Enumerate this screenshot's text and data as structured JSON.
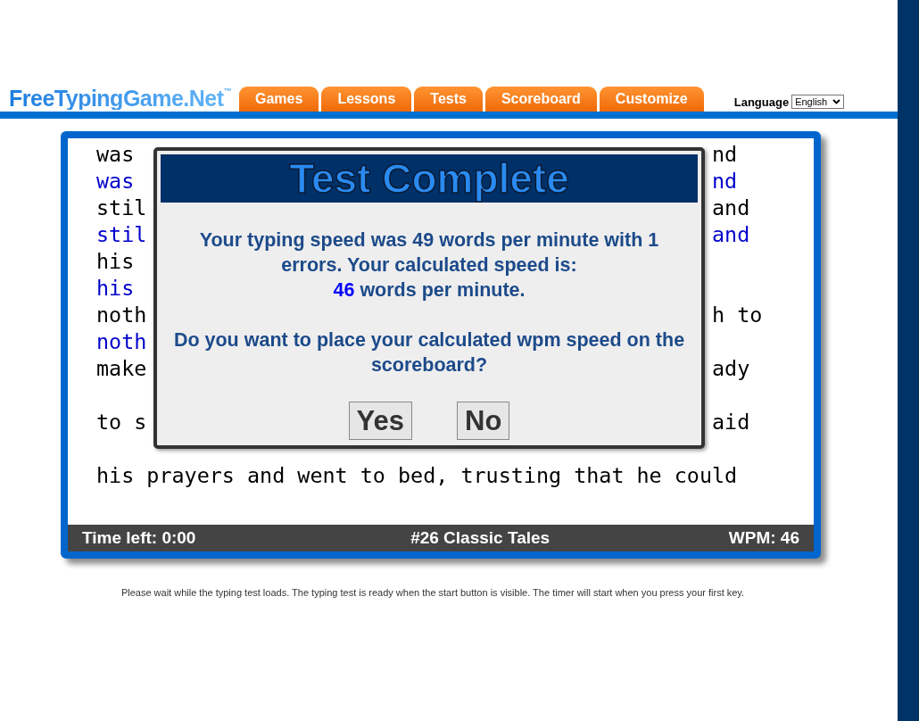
{
  "logo": {
    "name": "FreeTypingGame.Net",
    "mark": "™"
  },
  "nav_tabs": [
    "Games",
    "Lessons",
    "Tests",
    "Scoreboard",
    "Customize"
  ],
  "language": {
    "label": "Language",
    "value": "English"
  },
  "typing_text": [
    {
      "kind": "source",
      "left": "was",
      "right": "nd"
    },
    {
      "kind": "typed",
      "left": "was",
      "right": "nd"
    },
    {
      "kind": "source",
      "left": "stil",
      "right": "and"
    },
    {
      "kind": "typed",
      "left": "stil",
      "right": "and"
    },
    {
      "kind": "source",
      "left": "his"
    },
    {
      "kind": "typed",
      "left": "his"
    },
    {
      "kind": "source",
      "left": "noth",
      "right": "h to"
    },
    {
      "kind": "typed",
      "left": "noth"
    },
    {
      "kind": "source",
      "left": "make",
      "right": "ady"
    },
    {
      "kind": "blank"
    },
    {
      "kind": "source",
      "left": "to s",
      "right": "aid"
    },
    {
      "kind": "blank"
    },
    {
      "kind": "source",
      "left": "his prayers and went to bed, trusting that he could"
    }
  ],
  "dialog": {
    "title": "Test Complete",
    "result": "Your typing speed was 49 words per minute with 1 errors. Your calculated speed is:",
    "speed_value": "46",
    "speed_unit": "words per minute.",
    "question": "Do you want to place your calculated wpm speed on the scoreboard?",
    "buttons": [
      "Yes",
      "No"
    ]
  },
  "status_bar": {
    "time_left": "Time left: 0:00",
    "test_name": "#26 Classic Tales",
    "wpm": "WPM: 46"
  },
  "footer_note": "Please wait while the typing test loads. The typing test is ready when the start button is visible. The timer will start when you press your first key."
}
